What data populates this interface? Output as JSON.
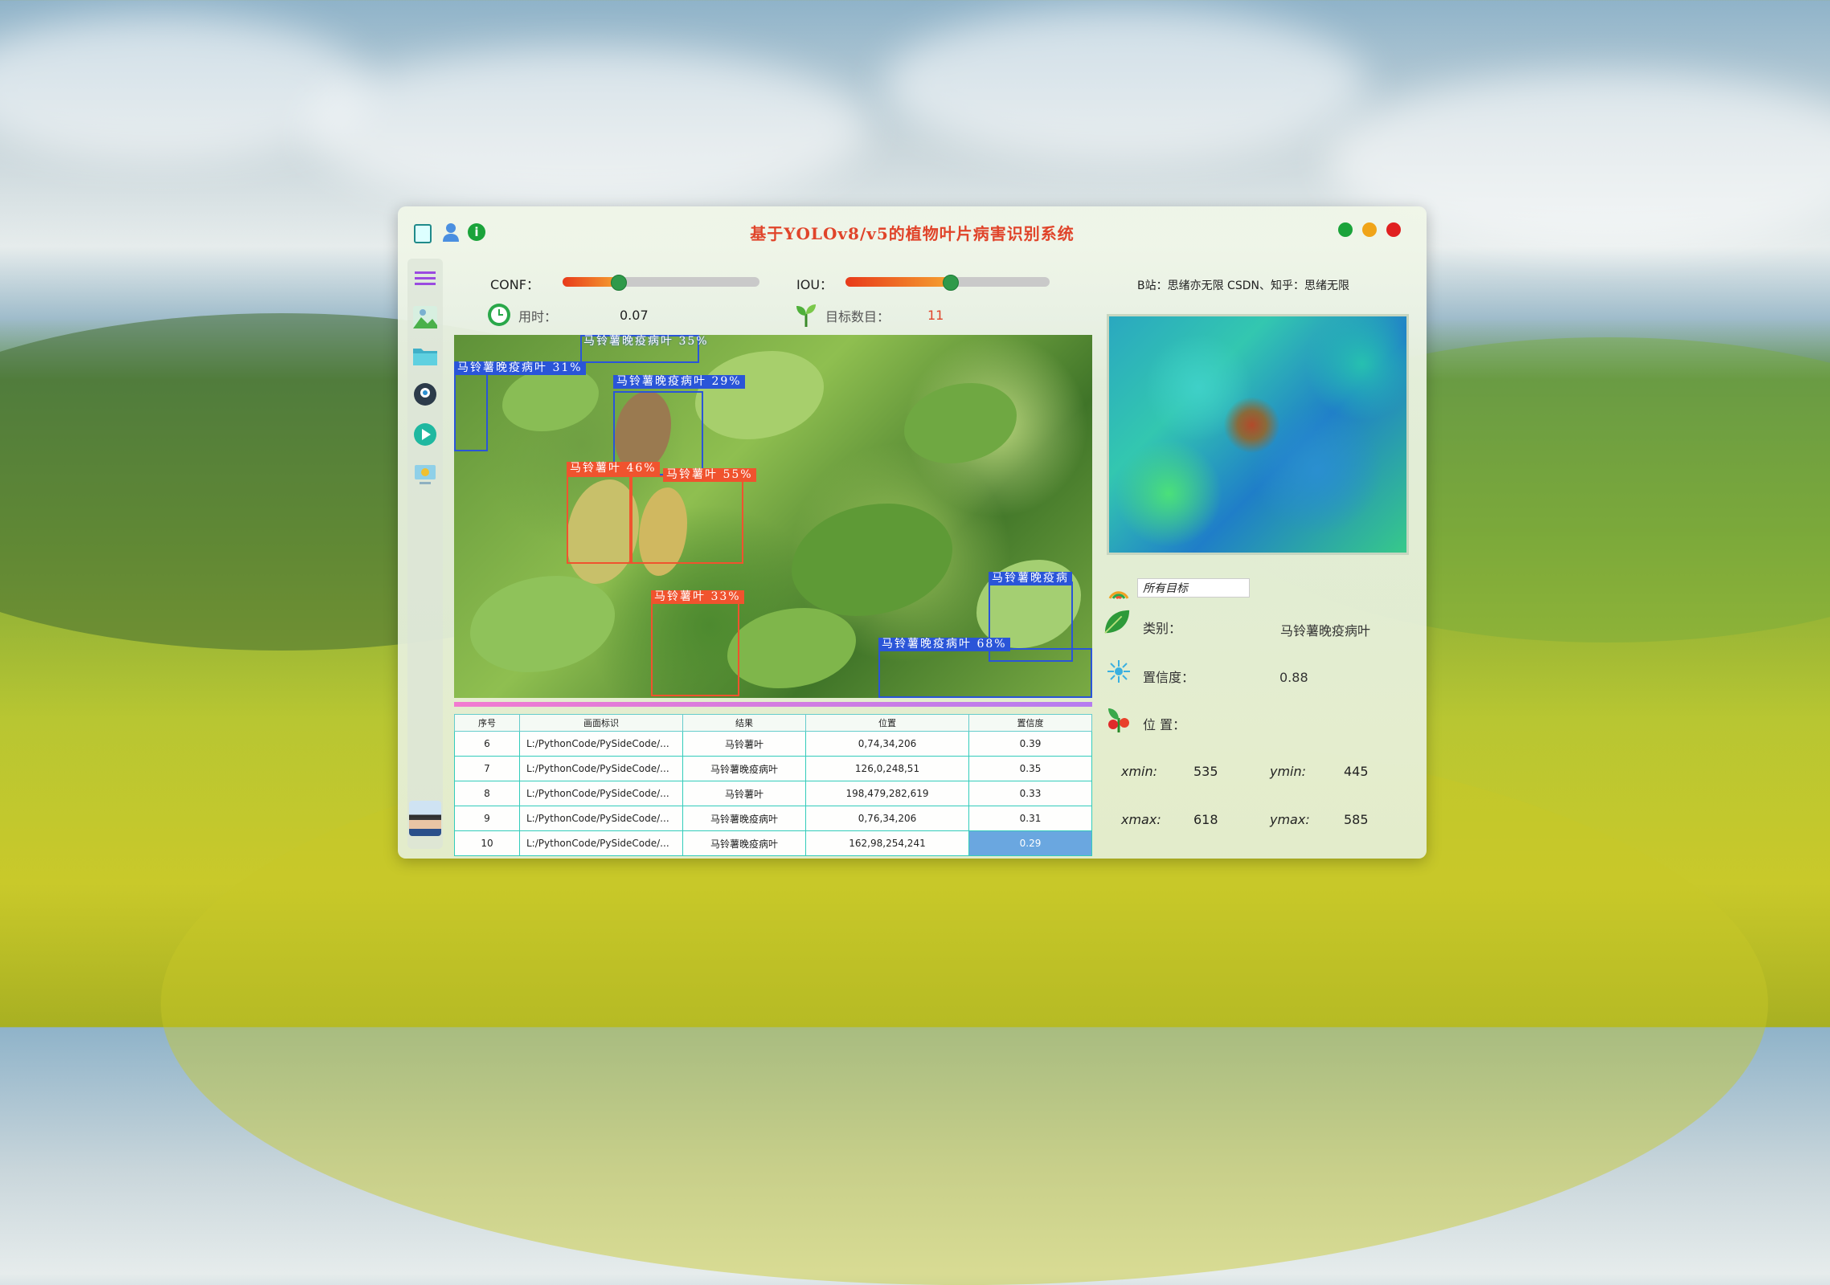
{
  "window": {
    "title": "基于YOLOv8/v5的植物叶片病害识别系统",
    "credit": "B站：思绪亦无限 CSDN、知乎：思绪无限"
  },
  "titlebar_icons": [
    "notebook-icon",
    "user-icon",
    "info-icon"
  ],
  "window_controls": {
    "colors": [
      "#1aa33a",
      "#f0a418",
      "#e02020"
    ]
  },
  "sidebar": {
    "items": [
      "menu-icon",
      "image-icon",
      "folder-icon",
      "camera-icon",
      "play-icon",
      "settings-icon"
    ]
  },
  "controls": {
    "conf_label": "CONF：",
    "conf_value": 0.28,
    "iou_label": "IOU：",
    "iou_value": 0.51,
    "time_label": "用时：",
    "time_value": "0.07",
    "count_label": "目标数目：",
    "count_value": "11"
  },
  "detections": [
    {
      "label": "马铃薯晚疫病叶  35%",
      "color": "#2a55d8"
    },
    {
      "label": "马铃薯晚疫病叶  31%",
      "color": "#2a55d8"
    },
    {
      "label": "马铃薯晚疫病叶  29%",
      "color": "#2a55d8"
    },
    {
      "label": "马铃薯叶  46%",
      "color": "#f0532e"
    },
    {
      "label": "马铃薯叶  55%",
      "color": "#f0532e"
    },
    {
      "label": "马铃薯叶  33%",
      "color": "#f0532e"
    },
    {
      "label": "马铃薯晚疫病",
      "color": "#2a55d8"
    },
    {
      "label": "马铃薯晚疫病叶  68%",
      "color": "#2a55d8"
    }
  ],
  "table": {
    "headers": [
      "序号",
      "画面标识",
      "结果",
      "位置",
      "置信度"
    ],
    "rows": [
      [
        "6",
        "L:/PythonCode/PySideCode/...",
        "马铃薯叶",
        "0,74,34,206",
        "0.39"
      ],
      [
        "7",
        "L:/PythonCode/PySideCode/...",
        "马铃薯晚疫病叶",
        "126,0,248,51",
        "0.35"
      ],
      [
        "8",
        "L:/PythonCode/PySideCode/...",
        "马铃薯叶",
        "198,479,282,619",
        "0.33"
      ],
      [
        "9",
        "L:/PythonCode/PySideCode/...",
        "马铃薯晚疫病叶",
        "0,76,34,206",
        "0.31"
      ],
      [
        "10",
        "L:/PythonCode/PySideCode/...",
        "马铃薯晚疫病叶",
        "162,98,254,241",
        "0.29"
      ]
    ],
    "selected_row": 4
  },
  "info": {
    "target_select": "所有目标",
    "class_label": "类别：",
    "class_value": "马铃薯晚疫病叶",
    "conf_label": "置信度：",
    "conf_value": "0.88",
    "pos_label": "位 置：",
    "xmin_label": "xmin:",
    "xmin_value": "535",
    "ymin_label": "ymin:",
    "ymin_value": "445",
    "xmax_label": "xmax:",
    "xmax_value": "618",
    "ymax_label": "ymax:",
    "ymax_value": "585"
  }
}
